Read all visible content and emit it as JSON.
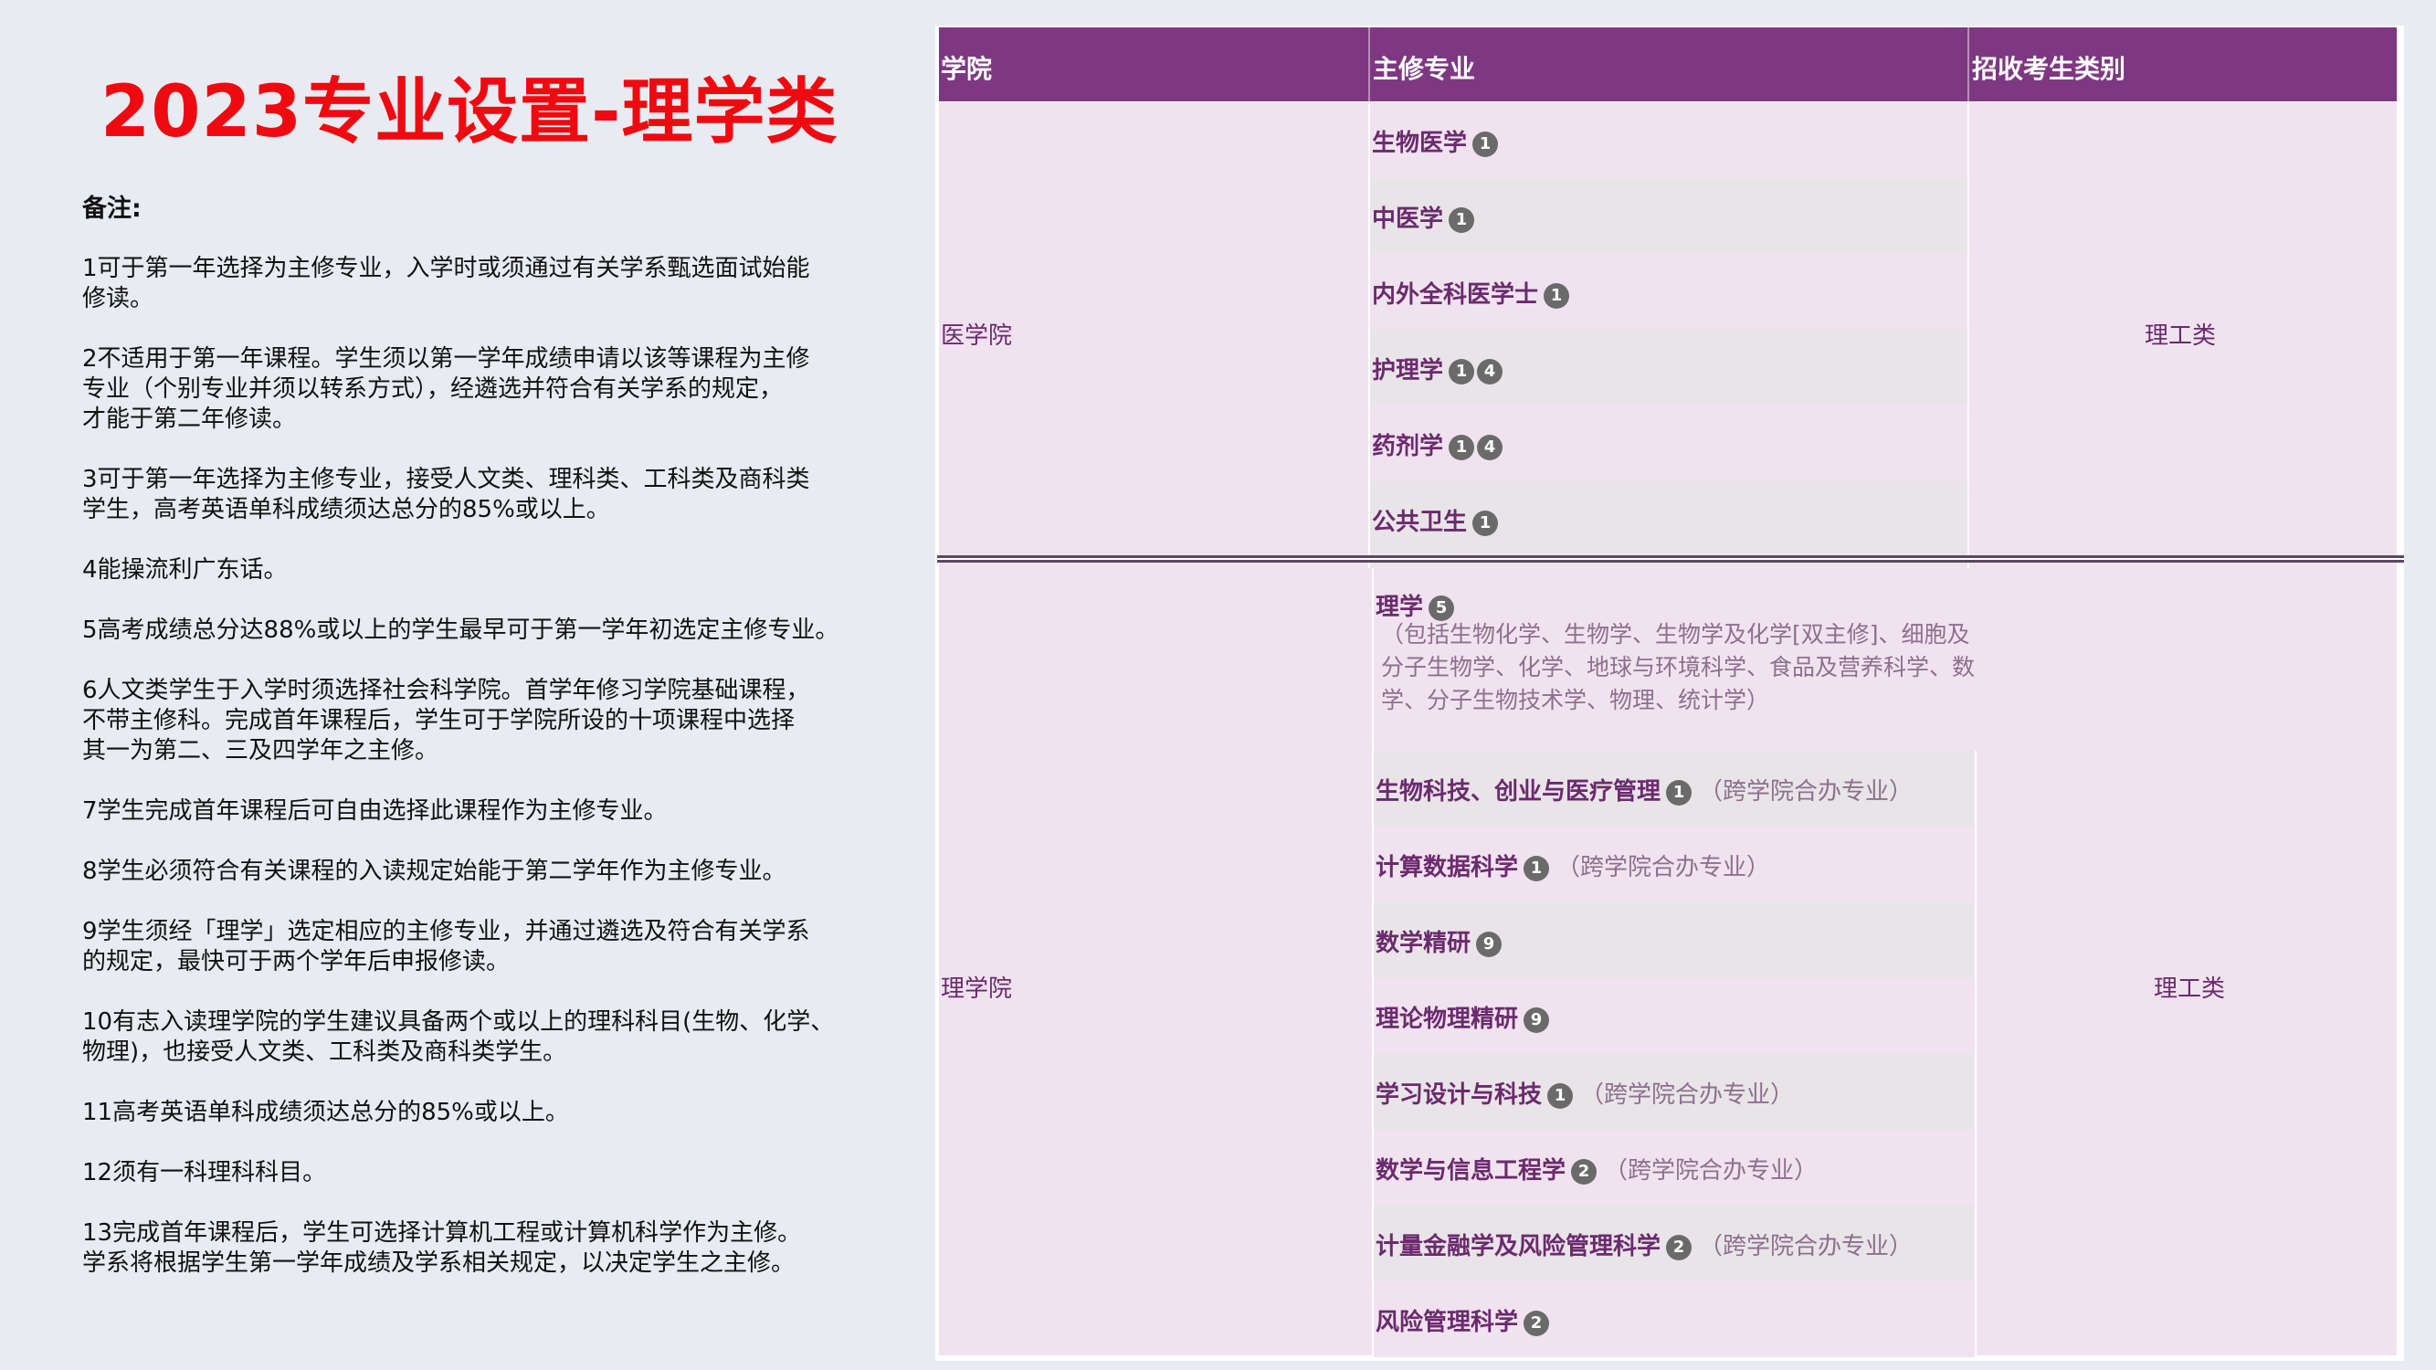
{
  "title": "2023专业设置-理学类",
  "notes_heading": "备注:",
  "notes": [
    "1可于第一年选择为主修专业，入学时或须通过有关学系甄选面试始能\n修读。",
    "2不适用于第一年课程。学生须以第一学年成绩申请以该等课程为主修\n专业（个别专业并须以转系方式），经遴选并符合有关学系的规定，\n才能于第二年修读。",
    "3可于第一年选择为主修专业，接受人文类、理科类、工科类及商科类\n学生，高考英语单科成绩须达总分的85%或以上。",
    "4能操流利广东话。",
    "5高考成绩总分达88%或以上的学生最早可于第一学年初选定主修专业。",
    "6人文类学生于入学时须选择社会科学院。首学年修习学院基础课程，\n不带主修科。完成首年课程后，学生可于学院所设的十项课程中选择\n其一为第二、三及四学年之主修。",
    "7学生完成首年课程后可自由选择此课程作为主修专业。",
    "8学生必须符合有关课程的入读规定始能于第二学年作为主修专业。",
    "9学生须经「理学」选定相应的主修专业，并通过遴选及符合有关学系\n的规定，最快可于两个学年后申报修读。",
    "10有志入读理学院的学生建议具备两个或以上的理科科目(生物、化学、\n物理)，也接受人文类、工科类及商科类学生。",
    "11高考英语单科成绩须达总分的85%或以上。",
    "12须有一科理科科目。",
    "13完成首年课程后，学生可选择计算机工程或计算机科学作为主修。\n学系将根据学生第一学年成绩及学系相关规定，以决定学生之主修。"
  ],
  "table": {
    "headers": [
      "学院",
      "主修专业",
      "招收考生类别"
    ],
    "sections": [
      {
        "college": "医学院",
        "category": "理工类",
        "majors": [
          {
            "name": "生物医学",
            "badges": [
              "1"
            ],
            "note": ""
          },
          {
            "name": "中医学",
            "badges": [
              "1"
            ],
            "note": ""
          },
          {
            "name": "内外全科医学士",
            "badges": [
              "1"
            ],
            "note": ""
          },
          {
            "name": "护理学",
            "badges": [
              "1",
              "4"
            ],
            "note": ""
          },
          {
            "name": "药剂学",
            "badges": [
              "1",
              "4"
            ],
            "note": ""
          },
          {
            "name": "公共卫生",
            "badges": [
              "1"
            ],
            "note": ""
          }
        ]
      },
      {
        "college": "理学院",
        "category": "理工类",
        "majors": [
          {
            "name": "理学",
            "badges": [
              "5"
            ],
            "note": "",
            "detail": "（包括生物化学、生物学、生物学及化学[双主修]、细胞及分子生物学、化学、地球与环境科学、食品及营养科学、数学、分子生物技术学、物理、统计学）"
          },
          {
            "name": "生物科技、创业与医疗管理",
            "badges": [
              "1"
            ],
            "note": "（跨学院合办专业）"
          },
          {
            "name": "计算数据科学",
            "badges": [
              "1"
            ],
            "note": "（跨学院合办专业）"
          },
          {
            "name": "数学精研",
            "badges": [
              "9"
            ],
            "note": ""
          },
          {
            "name": "理论物理精研",
            "badges": [
              "9"
            ],
            "note": ""
          },
          {
            "name": "学习设计与科技",
            "badges": [
              "1"
            ],
            "note": "（跨学院合办专业）"
          },
          {
            "name": "数学与信息工程学",
            "badges": [
              "2"
            ],
            "note": "（跨学院合办专业）"
          },
          {
            "name": "计量金融学及风险管理科学",
            "badges": [
              "2"
            ],
            "note": "（跨学院合办专业）"
          },
          {
            "name": "风险管理科学",
            "badges": [
              "2"
            ],
            "note": ""
          }
        ]
      }
    ]
  }
}
